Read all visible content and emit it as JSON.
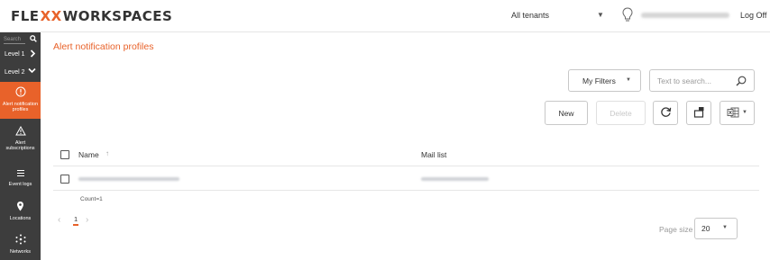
{
  "app": {
    "logo_part1": "FLE",
    "logo_part2": "XX",
    "logo_part3": "WORKSPACES"
  },
  "header": {
    "tenant_selected": "All tenants",
    "logoff_label": "Log Off",
    "icons": {
      "tenant_caret": "caret-down-icon",
      "notifications": "lightbulb-icon"
    }
  },
  "sidebar": {
    "search_placeholder": "Search",
    "levels": [
      {
        "label": "Level 1",
        "icon": "chevron-right-icon"
      },
      {
        "label": "Level 2",
        "icon": "chevron-down-icon"
      }
    ],
    "items": [
      {
        "label_line1": "Alert notification",
        "label_line2": "profiles",
        "icon": "alert-circle-icon",
        "active": true
      },
      {
        "label_line1": "Alert",
        "label_line2": "subscriptions",
        "icon": "warning-triangle-icon",
        "active": false
      },
      {
        "label_line1": "Event logs",
        "label_line2": "",
        "icon": "list-icon",
        "active": false
      },
      {
        "label_line1": "Locations",
        "label_line2": "",
        "icon": "map-pin-icon",
        "active": false
      },
      {
        "label_line1": "Networks",
        "label_line2": "",
        "icon": "network-icon",
        "active": false
      }
    ]
  },
  "main": {
    "title": "Alert notification profiles",
    "filters_label": "My Filters",
    "search_placeholder": "Text to search...",
    "buttons": {
      "new": "New",
      "delete": "Delete"
    },
    "table": {
      "columns": [
        "Name",
        "Mail list"
      ],
      "sort_indicator": "↑"
    },
    "count_label": "Count=1",
    "pagination": {
      "current_page": "1",
      "page_size_label": "Page size",
      "page_size_value": "20"
    }
  },
  "colors": {
    "accent": "#e8622a",
    "sidebar_bg": "#3d3d3d"
  }
}
